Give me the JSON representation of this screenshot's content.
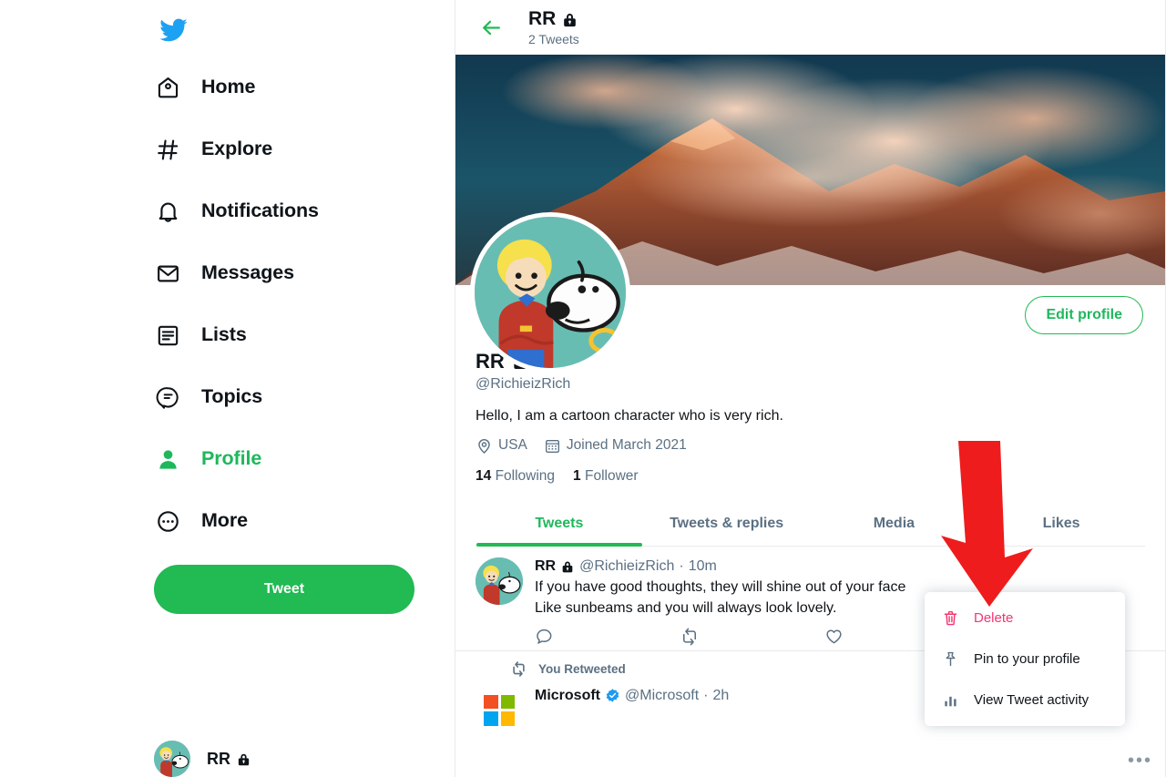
{
  "brand": {
    "logo_icon": "twitter-bird-icon",
    "logo_color": "#1da1f2",
    "accent_green": "#21ba53",
    "danger_pink": "#f4356f",
    "verified_blue": "#1d9bf0"
  },
  "sidebar": {
    "items": [
      {
        "label": "Home",
        "icon": "home-icon",
        "active": false
      },
      {
        "label": "Explore",
        "icon": "hashtag-icon",
        "active": false
      },
      {
        "label": "Notifications",
        "icon": "bell-icon",
        "active": false
      },
      {
        "label": "Messages",
        "icon": "envelope-icon",
        "active": false
      },
      {
        "label": "Lists",
        "icon": "list-icon",
        "active": false
      },
      {
        "label": "Topics",
        "icon": "topics-icon",
        "active": false
      },
      {
        "label": "Profile",
        "icon": "person-icon",
        "active": true
      },
      {
        "label": "More",
        "icon": "more-circle-icon",
        "active": false
      }
    ],
    "tweet_button": "Tweet",
    "account": {
      "name": "RR",
      "lock_icon": "lock-icon"
    }
  },
  "header": {
    "back_icon": "back-arrow-icon",
    "title": "RR",
    "lock_icon": "lock-icon",
    "subtitle": "2 Tweets"
  },
  "banner": {
    "description": "mountain-peak-with-orange-clouds"
  },
  "profile": {
    "edit_button": "Edit profile",
    "name": "RR",
    "lock_icon": "lock-icon",
    "handle": "@RichieizRich",
    "bio": "Hello, I am a cartoon character who is very rich.",
    "location_icon": "location-pin-icon",
    "location": "USA",
    "joined_icon": "calendar-icon",
    "joined": "Joined March 2021",
    "following_count": "14",
    "following_label": "Following",
    "followers_count": "1",
    "followers_label": "Follower"
  },
  "tabs": [
    {
      "label": "Tweets",
      "active": true
    },
    {
      "label": "Tweets & replies",
      "active": false
    },
    {
      "label": "Media",
      "active": false
    },
    {
      "label": "Likes",
      "active": false
    }
  ],
  "tweets": [
    {
      "author": "RR",
      "lock_icon": "lock-icon",
      "handle": "@RichieizRich",
      "separator": "·",
      "time": "10m",
      "text": "If you have good thoughts, they will shine out of your face\nLike sunbeams and you will always look lovely.",
      "actions": [
        {
          "name": "reply-icon",
          "count": ""
        },
        {
          "name": "retweet-icon",
          "count": ""
        },
        {
          "name": "like-icon",
          "count": ""
        },
        {
          "name": "share-icon",
          "count": ""
        }
      ]
    }
  ],
  "retweet_section": {
    "retweet_icon": "retweet-icon",
    "flag_label": "You Retweeted",
    "author": "Microsoft",
    "verified_icon": "verified-badge-icon",
    "handle": "@Microsoft",
    "separator": "·",
    "time": "2h"
  },
  "more_options": {
    "icon": "more-dots-icon",
    "label": "•••"
  },
  "dropdown": {
    "items": [
      {
        "label": "Delete",
        "icon": "trash-icon",
        "danger": true
      },
      {
        "label": "Pin to your profile",
        "icon": "pin-icon",
        "danger": false
      },
      {
        "label": "View Tweet activity",
        "icon": "bar-chart-icon",
        "danger": false
      }
    ]
  },
  "annotation": {
    "name": "red-down-arrow",
    "color": "#ee1c1c",
    "points_at": "Delete"
  }
}
